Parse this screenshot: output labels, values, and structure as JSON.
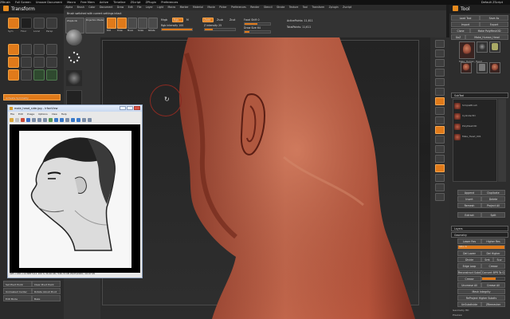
{
  "app": {
    "window_title_items": [
      "ZBrush",
      "Full Screen",
      "Unsave Document",
      "Macro",
      "Free Mem",
      "Active",
      "Timeline",
      "ZScript",
      "ZPlugin",
      "Preferences"
    ],
    "window_title_right": "Default ZScript",
    "colors": {
      "accent": "#e07a1a",
      "panel": "#2b2b2b",
      "canvas": "#232323"
    }
  },
  "menu": {
    "items": [
      "Alpha",
      "Brush",
      "Color",
      "Document",
      "Draw",
      "Edit",
      "File",
      "Layer",
      "Light",
      "Macro",
      "Marker",
      "Material",
      "Movie",
      "Picker",
      "Preferences",
      "Render",
      "Stencil",
      "Stroke",
      "Texture",
      "Tool",
      "Transform",
      "Zplugin",
      "Zscript"
    ]
  },
  "left_panel": {
    "title": "Transform",
    "labels": [
      "Sym",
      "Activate Symmetry",
      "Floor",
      "Local",
      "Persp",
      "Frame",
      "Move",
      "Scale",
      "Rotate",
      "PolyF",
      "Transp",
      "Ghost",
      "Solo"
    ],
    "bottom_buttons": [
      "Set Pivot Point",
      "Clear Pivot Point",
      "Unmasked Center",
      "Rotate About Pivot",
      "Edit Mode",
      "Bake"
    ]
  },
  "top_shelf": {
    "status": "Brush switched with current settings intact",
    "buttons": [
      "ZAppLink",
      "Projection Master",
      "Edit",
      "Draw",
      "Move",
      "Scale",
      "Rotate"
    ],
    "readouts": [
      {
        "label": "Mrgb",
        "value": ""
      },
      {
        "label": "Rgb",
        "value": ""
      },
      {
        "label": "M",
        "value": ""
      },
      {
        "label": "Zadd",
        "value": ""
      },
      {
        "label": "Zsub",
        "value": ""
      },
      {
        "label": "Zcut",
        "value": ""
      }
    ],
    "rgb_intensity": {
      "label": "Rgb Intensity 100",
      "value": 100
    },
    "z_intensity": {
      "label": "Z Intensity 25",
      "value": 25
    },
    "focal_shift": {
      "label": "Focal Shift 0",
      "value": 0
    },
    "draw_size": {
      "label": "Draw Size 64",
      "value": 64
    },
    "active_points": "ActivePoints: 11,611",
    "total_points": "TotalPoints: 11,611"
  },
  "right_strip": {
    "buttons": [
      "Bpr",
      "SPix",
      "Scroll",
      "Zoom",
      "Actual",
      "AAHalf",
      "Persp",
      "Floor",
      "Local",
      "LSym",
      "Frame",
      "Move",
      "Scale",
      "Rotate",
      "PolyF",
      "Transp",
      "Solo"
    ]
  },
  "tool_panel": {
    "title": "Tool",
    "buttons": [
      [
        "Load Tool",
        "Save As"
      ],
      [
        "Import",
        "Export"
      ],
      [
        "Clone",
        "Make PolyMesh3D"
      ],
      [
        "GoZ",
        "Make_Human_Head"
      ],
      [
        "Lightbox",
        "Tools"
      ]
    ],
    "current_tool": "Male_Human_Head",
    "subtool_items": [
      "SimpleBrush",
      "Cylinder3D",
      "PolyMesh3D",
      "Male_Head_001"
    ],
    "subtool_section": "SubTool",
    "subtool_buttons": [
      "All Low",
      "All High",
      "Append",
      "Duplicate",
      "Insert",
      "Delete",
      "Remesh",
      "Project All",
      "Extract",
      "Split"
    ],
    "layers": "Layers",
    "geometry_section": "Geometry",
    "geometry_buttons": [
      [
        "Lower Res",
        "Higher Res"
      ],
      [
        "SDiv 6",
        ""
      ],
      [
        "Del Lower",
        "Del Higher"
      ],
      [
        "Divide",
        ""
      ],
      [
        "Smt",
        "Suv"
      ],
      [
        "Edge Loop",
        "Crease"
      ],
      [
        "Reconstruct Subdiv",
        "Convert BPR To Geo"
      ],
      [
        "Crease",
        "CreaseLvl 15"
      ],
      [
        "Uncrease All",
        "Crease All"
      ],
      [
        "Mesh Integrity",
        ""
      ],
      [
        "ReProject Higher Subdiv",
        ""
      ],
      [
        "UnSubdivide",
        "ZRemesher"
      ]
    ],
    "geometry_hd": "Geometry HD",
    "preview": "Preview"
  },
  "image_viewer": {
    "title": "male_head_side.jpg - IrfanView",
    "menu": [
      "File",
      "Edit",
      "Image",
      "Options",
      "View",
      "Help"
    ],
    "status": "428 x 436 x 24 BPP   5/12   100 %   39.46 KB / 546.74 KB   05/05/2009 / 10:07:05"
  }
}
